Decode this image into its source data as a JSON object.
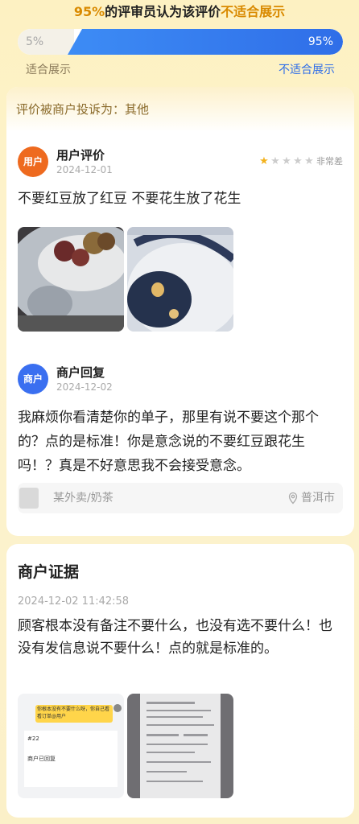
{
  "vote": {
    "percent_prefix": "95%",
    "headline_mid": "的评审员认为该评价",
    "headline_verdict": "不适合展示",
    "suitable_percent": "5%",
    "unsuitable_percent": "95%",
    "suitable_fraction": 0.05,
    "label_suitable": "适合展示",
    "label_unsuitable": "不适合展示"
  },
  "complaint": {
    "text": "评价被商户投诉为：其他"
  },
  "user_review": {
    "avatar_text": "用户",
    "title": "用户评价",
    "date": "2024-12-01",
    "stars": 1,
    "max_stars": 5,
    "rating_text": "非常差",
    "text": "不要红豆放了红豆 不要花生放了花生",
    "photo_count": 2
  },
  "merchant_reply": {
    "avatar_text": "商户",
    "title": "商户回复",
    "date": "2024-12-02",
    "text": "我麻烦你看清楚你的单子，那里有说不要这个那个的？点的是标准！你是意念说的不要红豆跟花生吗！？真是不好意思我不会接受意念。"
  },
  "store": {
    "name": "某外卖/奶茶",
    "city": "普洱市"
  },
  "evidence": {
    "title": "商户证据",
    "time": "2024-12-02 11:42:58",
    "text": "顾客根本没有备注不要什么，也没有选不要什么！也没有发信息说不要什么！点的就是标准的。",
    "screenshot_bubble": "你根本没有不要什么呀，你自己看看订单@用户",
    "screenshot_order": "#22",
    "screenshot_status": "商户已回复"
  },
  "colors": {
    "accent_blue": "#2f6ee8",
    "accent_orange": "#ee6a1f",
    "verdict_gold": "#d98a00"
  }
}
